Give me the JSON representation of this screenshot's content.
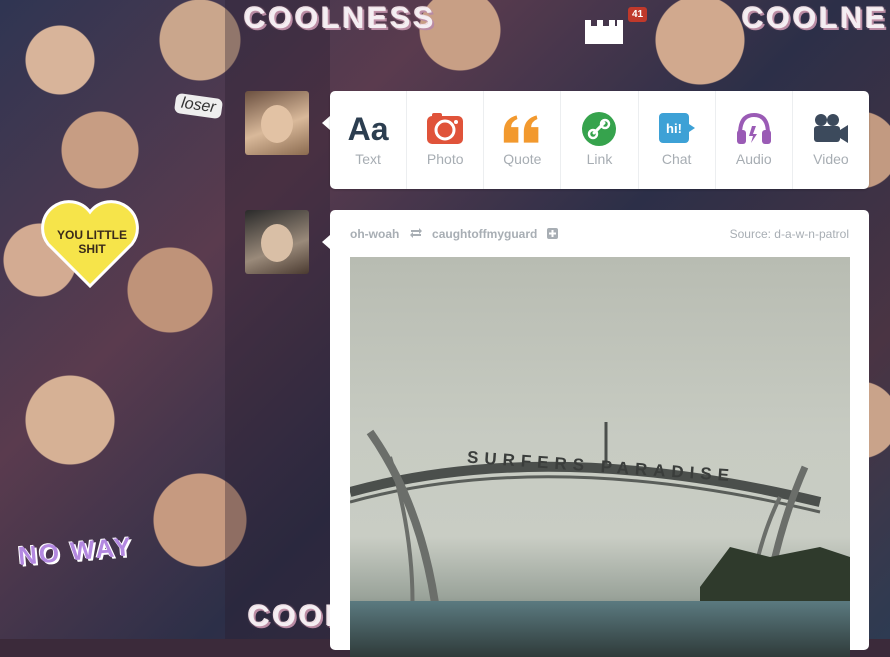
{
  "background": {
    "coolness_texts": [
      "COOLNESS",
      "COOLNE",
      "COOL"
    ],
    "heart_text": "YOU LITTLE SHIT",
    "loser_text": "loser",
    "noway_text": "NO WAY"
  },
  "header": {
    "notification_count": "41"
  },
  "post_types": [
    {
      "label": "Text",
      "glyph": "Aa",
      "color": "#2c3e50"
    },
    {
      "label": "Photo",
      "color": "#e0533a"
    },
    {
      "label": "Quote",
      "color": "#f2992e"
    },
    {
      "label": "Link",
      "color": "#36a34d"
    },
    {
      "label": "Chat",
      "color": "#3da1d6"
    },
    {
      "label": "Audio",
      "color": "#9a5bb5"
    },
    {
      "label": "Video",
      "color": "#3c4a5c"
    }
  ],
  "post": {
    "author": "oh-woah",
    "reblogged_from": "caughtoffmyguard",
    "source_label": "Source: d-a-w-n-patrol",
    "photo_sign": "SURFERS PARADISE"
  }
}
